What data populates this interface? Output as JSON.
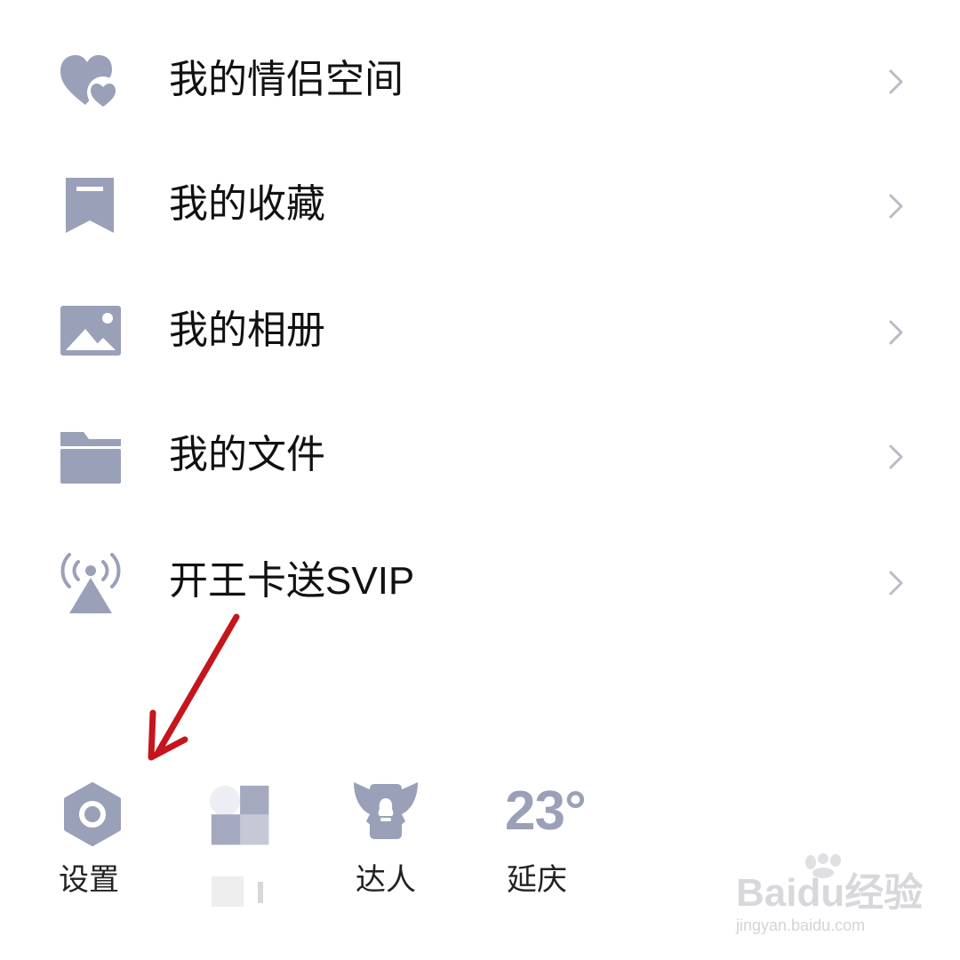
{
  "colors": {
    "icon": "#9aa0b8",
    "text": "#111111",
    "chevron": "#b8bcc8",
    "arrow": "#c4161c"
  },
  "menu": {
    "items": [
      {
        "label": "我的情侣空间",
        "icon": "couple-hearts-icon"
      },
      {
        "label": "我的收藏",
        "icon": "bookmark-icon"
      },
      {
        "label": "我的相册",
        "icon": "photo-album-icon"
      },
      {
        "label": "我的文件",
        "icon": "folder-icon"
      },
      {
        "label": "开王卡送SVIP",
        "icon": "broadcast-tower-icon"
      }
    ]
  },
  "bottom_bar": {
    "settings": {
      "label": "设置",
      "icon": "settings-hex-icon"
    },
    "blurred": {
      "icon": "blurred-icon"
    },
    "daren": {
      "label": "达人",
      "icon": "winged-badge-icon"
    },
    "weather": {
      "temp": "23°",
      "city": "延庆"
    }
  },
  "watermark": {
    "brand": "Baidu经验",
    "url": "jingyan.baidu.com"
  }
}
